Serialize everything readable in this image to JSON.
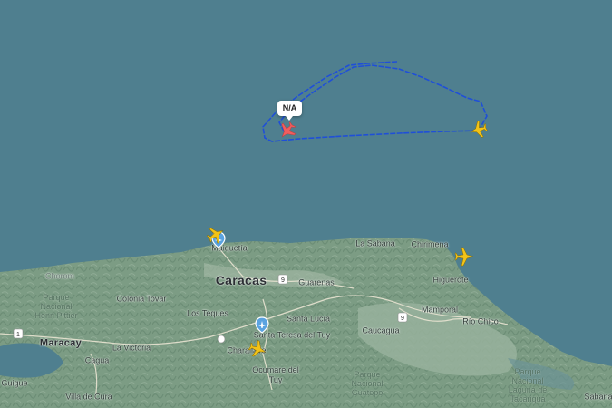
{
  "map": {
    "type": "flight-tracker",
    "flight_label": "N/A",
    "colors": {
      "sea": "#4f7f8f",
      "land": "#7c9c84",
      "track": "#1f4fd8",
      "selected_aircraft": "#f05d5e",
      "aircraft": "#f2c318",
      "airport_marker": "#5ba3e0"
    },
    "places": {
      "caracas": "Caracas",
      "maiquetia": "Maiquetía",
      "la_sabana": "La Sabana",
      "chirimena": "Chirimena",
      "higuerote": "Higuerote",
      "chorom": "Chorom",
      "guarenas": "Guarenas",
      "colonia_tovar": "Colonia Tovar",
      "los_teques": "Los Teques",
      "santa_lucia": "Santa Lucía",
      "santa_teresa": "Santa Teresa del Tuy",
      "mamporal": "Mamporal",
      "rio_chico": "Río Chico",
      "caucagua": "Caucagua",
      "maracay": "Maracay",
      "la_victoria": "La Victoria",
      "cagua": "Cagua",
      "charallave": "Charallave",
      "ocumare": "Ocumare del Tuy",
      "guigue": "Guigue",
      "villa_de_cura": "Villa de Cura",
      "sabana": "Sabana",
      "park_henri_pittier": "Parque\nNacional\nHenri Pittier",
      "park_guatopo": "Parque\nNacional\nGuatopo",
      "park_laguna": "Parque\nNacional\nLaguna de\nTacarigua"
    },
    "road_shields": [
      "9",
      "1",
      "9"
    ],
    "aircraft": [
      {
        "name": "selected-aircraft-icon",
        "color": "selected"
      },
      {
        "name": "aircraft-icon-east",
        "color": "yellow"
      },
      {
        "name": "aircraft-icon-higuerote",
        "color": "yellow"
      },
      {
        "name": "aircraft-icon-maiquetia",
        "color": "yellow"
      },
      {
        "name": "aircraft-icon-charallave",
        "color": "yellow"
      }
    ]
  }
}
